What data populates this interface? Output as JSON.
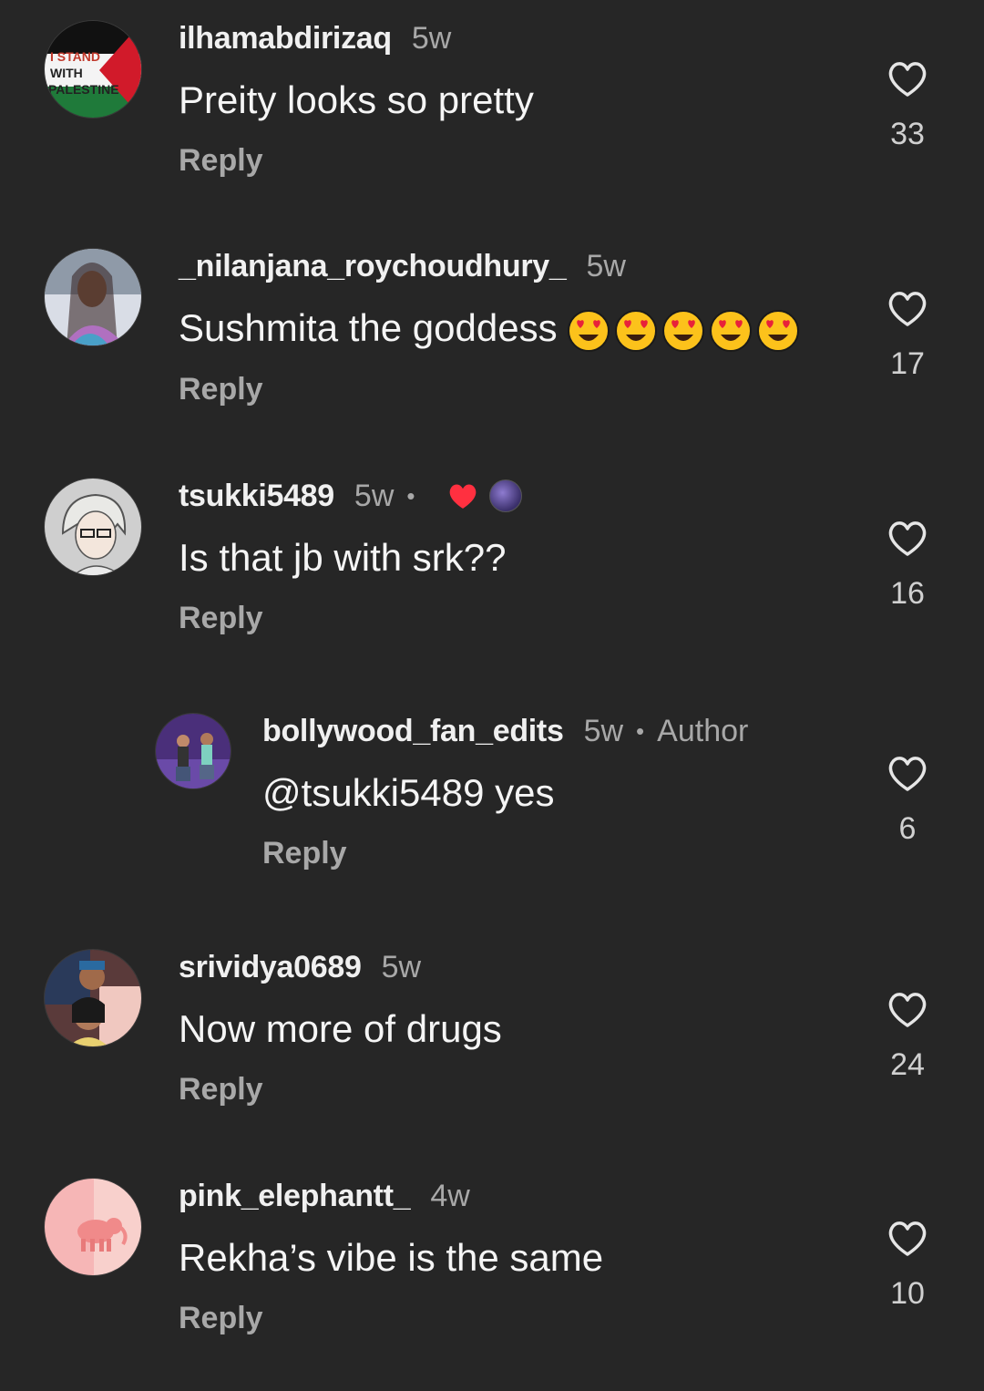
{
  "comments": [
    {
      "username": "ilhamabdirizaq",
      "time": "5w",
      "text": "Preity looks so pretty",
      "reply": "Reply",
      "likes": "33",
      "avatar_text": {
        "l1": "I STAND",
        "l2": "WITH",
        "l3": "PALESTINE"
      }
    },
    {
      "username": "_nilanjana_roychoudhury_",
      "time": "5w",
      "text": "Sushmita the goddess",
      "reply": "Reply",
      "likes": "17"
    },
    {
      "username": "tsukki5489",
      "time": "5w",
      "text": "Is that jb with srk??",
      "reply": "Reply",
      "likes": "16"
    },
    {
      "username": "bollywood_fan_edits",
      "time": "5w",
      "author_tag": "Author",
      "text": "@tsukki5489 yes",
      "reply": "Reply",
      "likes": "6"
    },
    {
      "username": "srividya0689",
      "time": "5w",
      "text": "Now more of drugs",
      "reply": "Reply",
      "likes": "24"
    },
    {
      "username": "pink_elephantt_",
      "time": "4w",
      "text": "Rekha’s vibe is the same",
      "reply": "Reply",
      "likes": "10"
    }
  ],
  "icons": {
    "like": "heart-outline-icon",
    "liked_by_author": "heart-filled-icon",
    "emoji": "heart-eyes-emoji"
  },
  "colors": {
    "background": "#262626",
    "secondary_text": "#a8a8a8",
    "heart_red": "#ff3040"
  }
}
